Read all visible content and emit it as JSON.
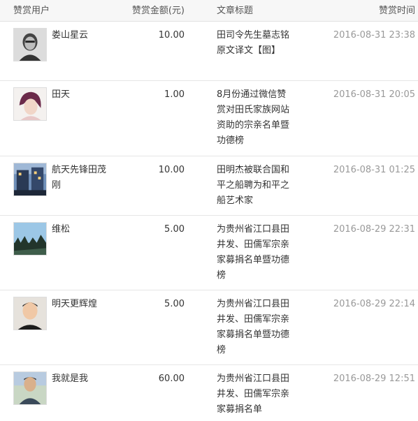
{
  "header": {
    "user": "赞赏用户",
    "amount": "赞赏金额(元)",
    "title": "文章标题",
    "time": "赞赏时间"
  },
  "rows": [
    {
      "user": "娄山星云",
      "amount": "10.00",
      "title": "田司令先生墓志铭原文译文【图】",
      "time": "2016-08-31 23:38",
      "avatar": "avatar-portrait-bw-icon"
    },
    {
      "user": "田天",
      "amount": "1.00",
      "title": "8月份通过微信赞赏对田氏家族网站资助的宗亲名单暨功德榜",
      "time": "2016-08-31 20:05",
      "avatar": "avatar-woman-icon"
    },
    {
      "user": "航天先锋田茂刚",
      "amount": "10.00",
      "title": "田明杰被联合国和平之船聘为和平之船艺术家",
      "time": "2016-08-31 01:25",
      "avatar": "avatar-building-icon"
    },
    {
      "user": "维松",
      "amount": "5.00",
      "title": "为贵州省江口县田井发、田儒军宗亲家募捐名单暨功德榜",
      "time": "2016-08-29 22:31",
      "avatar": "avatar-landscape-icon"
    },
    {
      "user": "明天更辉煌",
      "amount": "5.00",
      "title": "为贵州省江口县田井发、田儒军宗亲家募捐名单暨功德榜",
      "time": "2016-08-29 22:14",
      "avatar": "avatar-man-icon"
    },
    {
      "user": "我就是我",
      "amount": "60.00",
      "title": "为贵州省江口县田井发、田儒军宗亲家募捐名单",
      "time": "2016-08-29 12:51",
      "avatar": "avatar-man-outdoor-icon"
    }
  ]
}
